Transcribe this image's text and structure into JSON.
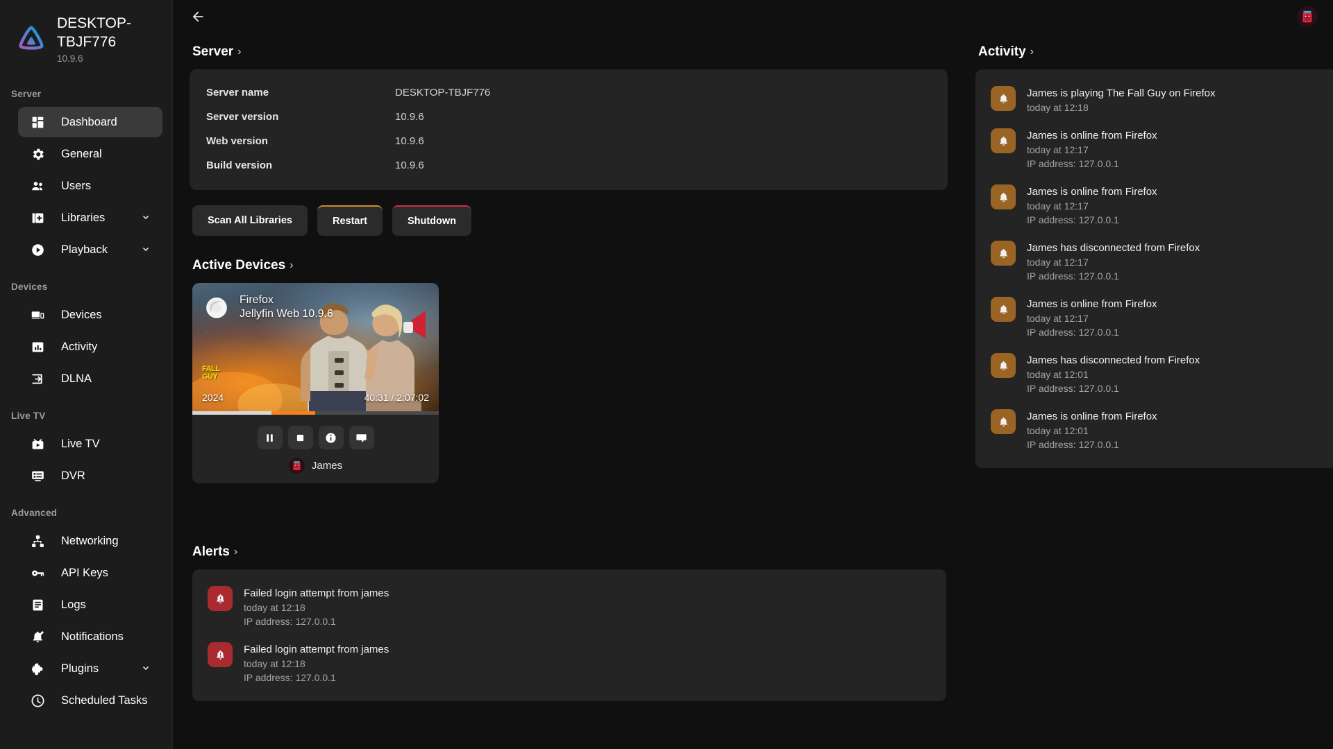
{
  "sidebar": {
    "brand": {
      "title": "DESKTOP-TBJF776",
      "version": "10.9.6",
      "logo_icon": "jellyfin-logo-icon"
    },
    "sections": [
      {
        "label": "Server",
        "items": [
          {
            "label": "Dashboard",
            "icon": "dashboard-icon",
            "active": true,
            "expandable": false
          },
          {
            "label": "General",
            "icon": "gear-icon",
            "active": false,
            "expandable": false
          },
          {
            "label": "Users",
            "icon": "users-icon",
            "active": false,
            "expandable": false
          },
          {
            "label": "Libraries",
            "icon": "library-add-icon",
            "active": false,
            "expandable": true
          },
          {
            "label": "Playback",
            "icon": "play-circle-icon",
            "active": false,
            "expandable": true
          }
        ]
      },
      {
        "label": "Devices",
        "items": [
          {
            "label": "Devices",
            "icon": "devices-icon",
            "active": false,
            "expandable": false
          },
          {
            "label": "Activity",
            "icon": "chart-bar-icon",
            "active": false,
            "expandable": false
          },
          {
            "label": "DLNA",
            "icon": "input-arrow-icon",
            "active": false,
            "expandable": false
          }
        ]
      },
      {
        "label": "Live TV",
        "items": [
          {
            "label": "Live TV",
            "icon": "live-tv-icon",
            "active": false,
            "expandable": false
          },
          {
            "label": "DVR",
            "icon": "dvr-icon",
            "active": false,
            "expandable": false
          }
        ]
      },
      {
        "label": "Advanced",
        "items": [
          {
            "label": "Networking",
            "icon": "network-icon",
            "active": false,
            "expandable": false
          },
          {
            "label": "API Keys",
            "icon": "key-icon",
            "active": false,
            "expandable": false
          },
          {
            "label": "Logs",
            "icon": "logs-icon",
            "active": false,
            "expandable": false
          },
          {
            "label": "Notifications",
            "icon": "notification-bell-icon",
            "active": false,
            "expandable": false
          },
          {
            "label": "Plugins",
            "icon": "puzzle-icon",
            "active": false,
            "expandable": true
          },
          {
            "label": "Scheduled Tasks",
            "icon": "clock-icon",
            "active": false,
            "expandable": false
          }
        ]
      }
    ]
  },
  "topbar": {
    "back_icon": "back-arrow-icon",
    "avatar_icon": "user-avatar-icon"
  },
  "server": {
    "heading": "Server",
    "chevron": "›",
    "rows": [
      {
        "key": "Server name",
        "value": "DESKTOP-TBJF776"
      },
      {
        "key": "Server version",
        "value": "10.9.6"
      },
      {
        "key": "Web version",
        "value": "10.9.6"
      },
      {
        "key": "Build version",
        "value": "10.9.6"
      }
    ],
    "buttons": [
      {
        "label": "Scan All Libraries",
        "style": "plain"
      },
      {
        "label": "Restart",
        "style": "warn",
        "accent": "#d18b2c"
      },
      {
        "label": "Shutdown",
        "style": "danger",
        "accent": "#c9303c"
      }
    ]
  },
  "active_devices": {
    "heading": "Active Devices",
    "chevron": "›",
    "card": {
      "app_name": "Firefox",
      "client": "Jellyfin Web 10.9.6",
      "app_icon": "firefox-icon",
      "media_logo_line1": "FALL",
      "media_logo_line2": "GUY",
      "year": "2024",
      "time": "40:31 / 2:07:02",
      "progress_played_pct": 32,
      "progress_buffered_pct": 18,
      "controls": [
        {
          "name": "pause-button",
          "icon": "pause-icon"
        },
        {
          "name": "stop-button",
          "icon": "stop-icon"
        },
        {
          "name": "info-button",
          "icon": "info-icon"
        },
        {
          "name": "message-button",
          "icon": "message-icon"
        }
      ],
      "user": "James"
    }
  },
  "activity": {
    "heading": "Activity",
    "chevron": "›",
    "items": [
      {
        "title": "James is playing The Fall Guy on Firefox",
        "time": "today at 12:18",
        "ip": "",
        "severity": "amber",
        "icon": "bell-icon"
      },
      {
        "title": "James is online from Firefox",
        "time": "today at 12:17",
        "ip": "IP address: 127.0.0.1",
        "severity": "amber",
        "icon": "bell-icon"
      },
      {
        "title": "James is online from Firefox",
        "time": "today at 12:17",
        "ip": "IP address: 127.0.0.1",
        "severity": "amber",
        "icon": "bell-icon"
      },
      {
        "title": "James has disconnected from Firefox",
        "time": "today at 12:17",
        "ip": "IP address: 127.0.0.1",
        "severity": "amber",
        "icon": "bell-icon"
      },
      {
        "title": "James is online from Firefox",
        "time": "today at 12:17",
        "ip": "IP address: 127.0.0.1",
        "severity": "amber",
        "icon": "bell-icon"
      },
      {
        "title": "James has disconnected from Firefox",
        "time": "today at 12:01",
        "ip": "IP address: 127.0.0.1",
        "severity": "amber",
        "icon": "bell-icon"
      },
      {
        "title": "James is online from Firefox",
        "time": "today at 12:01",
        "ip": "IP address: 127.0.0.1",
        "severity": "amber",
        "icon": "bell-icon"
      }
    ]
  },
  "alerts": {
    "heading": "Alerts",
    "chevron": "›",
    "items": [
      {
        "title": "Failed login attempt from james",
        "time": "today at 12:18",
        "ip": "IP address: 127.0.0.1",
        "severity": "red",
        "icon": "alert-bell-icon"
      },
      {
        "title": "Failed login attempt from james",
        "time": "today at 12:18",
        "ip": "IP address: 127.0.0.1",
        "severity": "red",
        "icon": "alert-bell-icon"
      }
    ]
  },
  "colors": {
    "background": "#101010",
    "sidebar": "#1c1c1c",
    "panel": "#242424",
    "accent_orange": "#f58220",
    "danger": "#c9303c",
    "amber_icon": "#9a6424",
    "red_icon": "#a92a2f"
  }
}
